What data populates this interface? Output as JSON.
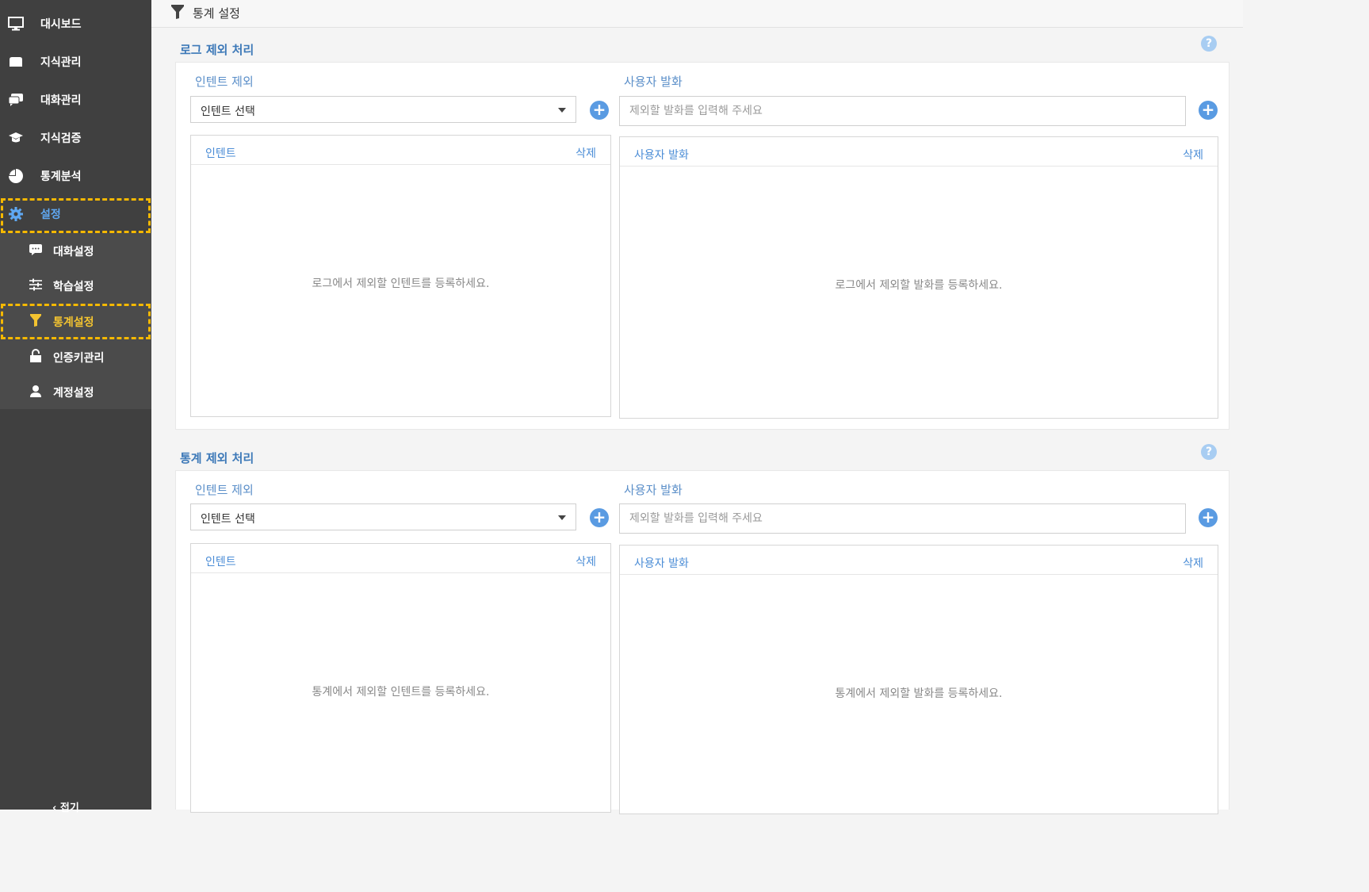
{
  "sidebar": {
    "items": [
      {
        "label": "대시보드",
        "icon": "monitor-icon"
      },
      {
        "label": "지식관리",
        "icon": "folder-icon"
      },
      {
        "label": "대화관리",
        "icon": "chat-icon"
      },
      {
        "label": "지식검증",
        "icon": "graduation-cap-icon"
      },
      {
        "label": "통계분석",
        "icon": "pie-chart-icon"
      },
      {
        "label": "설정",
        "icon": "gear-icon"
      }
    ],
    "submenu": [
      {
        "label": "대화설정",
        "icon": "speech-bubble-icon"
      },
      {
        "label": "학습설정",
        "icon": "sliders-icon"
      },
      {
        "label": "통계설정",
        "icon": "funnel-icon"
      },
      {
        "label": "인증키관리",
        "icon": "unlock-icon"
      },
      {
        "label": "계정설정",
        "icon": "user-icon"
      }
    ],
    "collapse_label": "접기"
  },
  "header": {
    "title": "통계 설정",
    "icon": "funnel-icon"
  },
  "sections": [
    {
      "title": "로그 제외 처리",
      "intent_label": "인텐트 제외",
      "intent_select": "인텐트 선택",
      "utter_label": "사용자 발화",
      "utter_placeholder": "제외할 발화를 입력해 주세요",
      "intent_list_header": "인텐트",
      "utter_list_header": "사용자 발화",
      "delete_label": "삭제",
      "intent_empty": "로그에서 제외할 인텐트를 등록하세요.",
      "utter_empty": "로그에서 제외할 발화를 등록하세요."
    },
    {
      "title": "통계 제외 처리",
      "intent_label": "인텐트 제외",
      "intent_select": "인텐트 선택",
      "utter_label": "사용자 발화",
      "utter_placeholder": "제외할 발화를 입력해 주세요",
      "intent_list_header": "인텐트",
      "utter_list_header": "사용자 발화",
      "delete_label": "삭제",
      "intent_empty": "통계에서 제외할 인텐트를 등록하세요.",
      "utter_empty": "통계에서 제외할 발화를 등록하세요."
    }
  ],
  "help_symbol": "?",
  "plus_symbol": "+",
  "colors": {
    "sidebar": "#404040",
    "accent": "#5a9be2",
    "highlight": "#f5b800"
  }
}
